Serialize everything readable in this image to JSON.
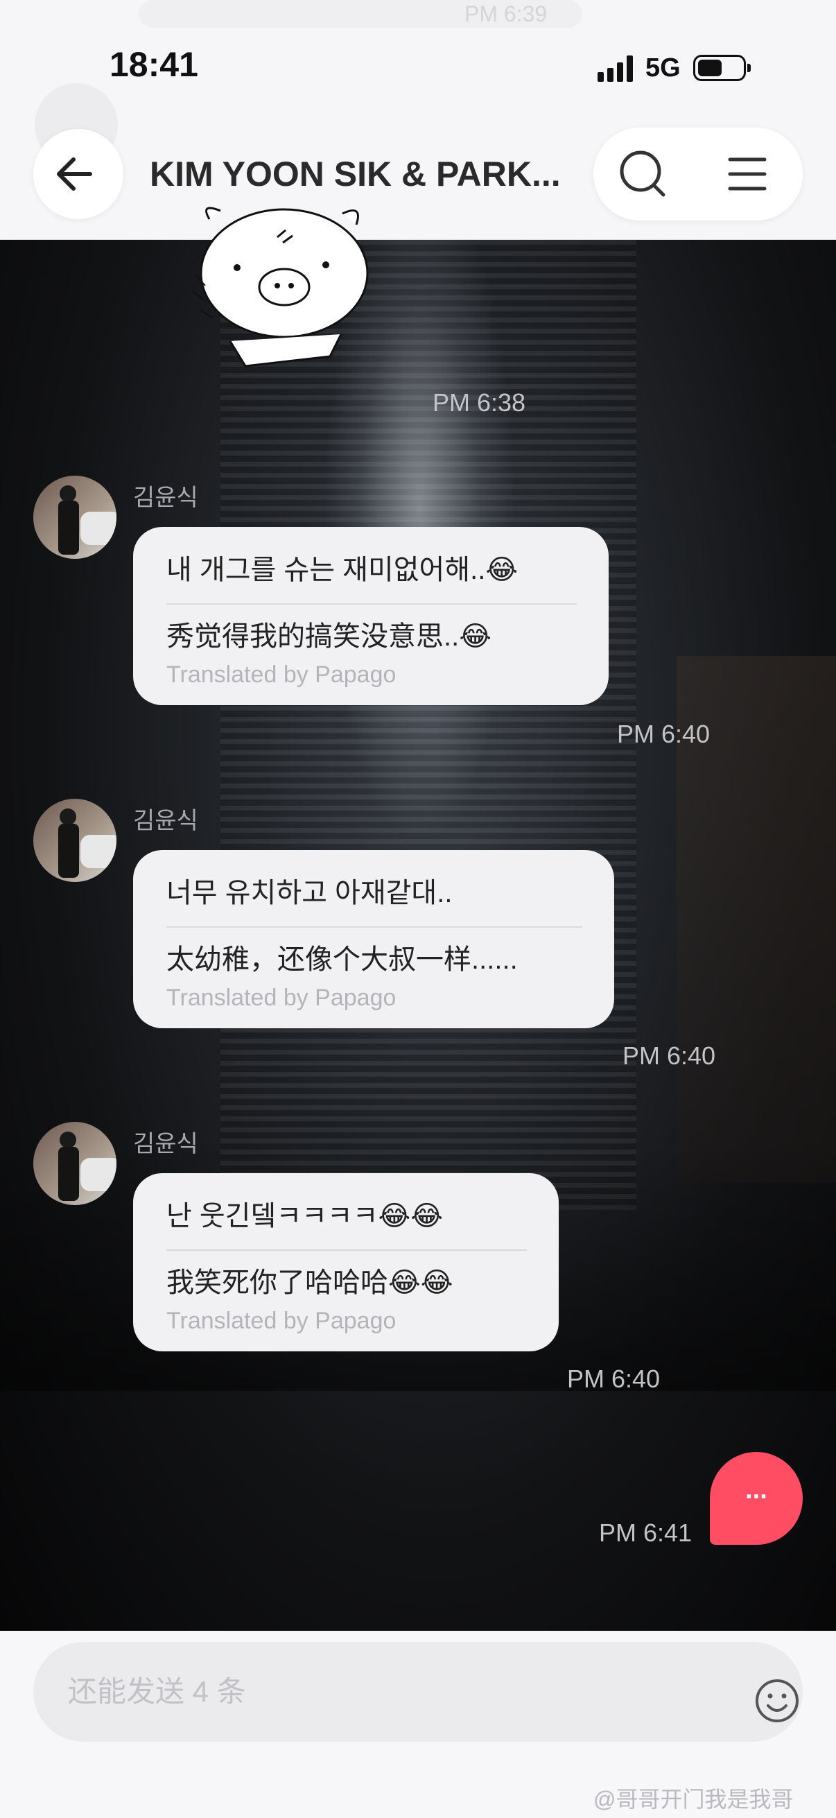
{
  "status_bar": {
    "time": "18:41",
    "network": "5G"
  },
  "ghost_row": {
    "time": "PM 6:39"
  },
  "header": {
    "title": "KIM YOON SIK & PARK..."
  },
  "messages": [
    {
      "sender": "김윤식",
      "korean": "내 개그를 슈는 재미없어해..😂",
      "chinese": "秀觉得我的搞笑没意思..😂",
      "translated_by": "Translated by Papago",
      "time": "PM 6:40"
    },
    {
      "sender": "김윤식",
      "korean": "너무 유치하고 아재같대..",
      "chinese": "太幼稚，还像个大叔一样......",
      "translated_by": "Translated by Papago",
      "time": "PM 6:40"
    },
    {
      "sender": "김윤식",
      "korean": "난 웃긴뎈ㅋㅋㅋㅋ😂😂",
      "chinese": "我笑死你了哈哈哈😂😂",
      "translated_by": "Translated by Papago",
      "time": "PM 6:40"
    }
  ],
  "sticker_time": "PM 6:38",
  "outgoing": {
    "typing": "...",
    "time": "PM 6:41"
  },
  "composer": {
    "placeholder": "还能发送 4 条"
  },
  "watermark": "@哥哥开门我是我哥",
  "colors": {
    "accent": "#ff4d63"
  },
  "icons": [
    "back-arrow-icon",
    "search-icon",
    "menu-icon",
    "smiley-icon",
    "signal-icon",
    "battery-icon"
  ]
}
